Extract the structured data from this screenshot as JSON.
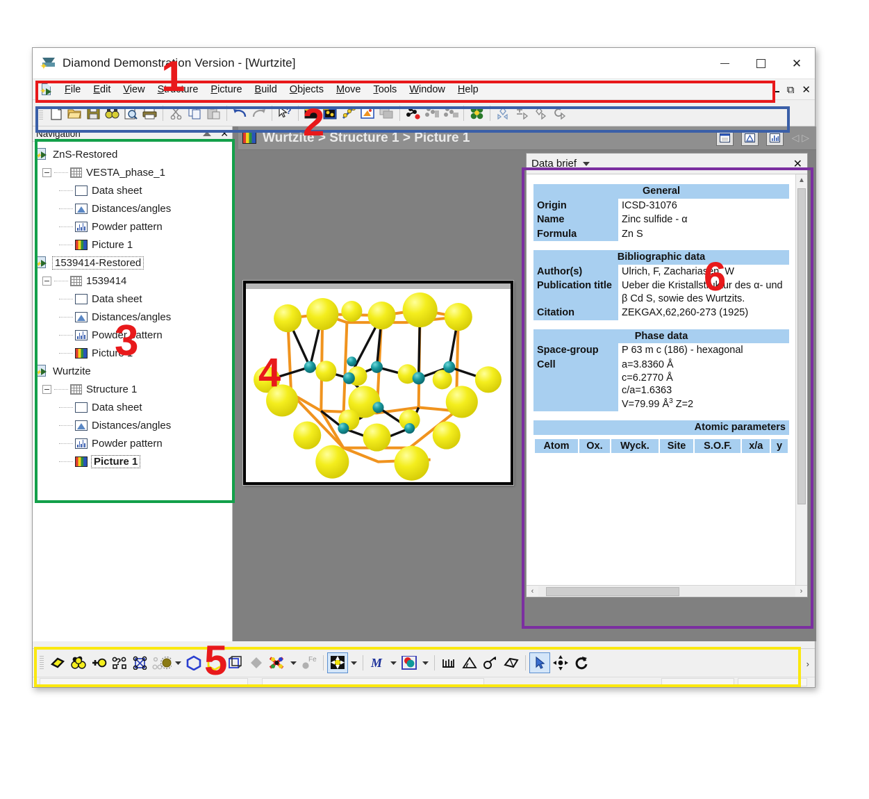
{
  "window": {
    "title": "Diamond Demonstration Version - [Wurtzite]",
    "app_icon": "diamond-icon",
    "minimize": "—",
    "maximize": "□",
    "close": "✕"
  },
  "menubar": {
    "doc_icon": "structure-document-icon",
    "items": [
      {
        "label": "File",
        "mnemonic": "F"
      },
      {
        "label": "Edit",
        "mnemonic": "E"
      },
      {
        "label": "View",
        "mnemonic": "V"
      },
      {
        "label": "Structure",
        "mnemonic": "S"
      },
      {
        "label": "Picture",
        "mnemonic": "P"
      },
      {
        "label": "Build",
        "mnemonic": "B"
      },
      {
        "label": "Objects",
        "mnemonic": "O"
      },
      {
        "label": "Move",
        "mnemonic": "M"
      },
      {
        "label": "Tools",
        "mnemonic": "T"
      },
      {
        "label": "Window",
        "mnemonic": "W"
      },
      {
        "label": "Help",
        "mnemonic": "H"
      }
    ],
    "mdi_restore": "❐",
    "mdi_close": "✕"
  },
  "toolbar_top": {
    "buttons": [
      {
        "name": "new-icon",
        "tip": "New"
      },
      {
        "name": "open-folder-icon",
        "tip": "Open"
      },
      {
        "name": "save-disk-icon",
        "tip": "Save"
      },
      {
        "name": "find-binoculars-icon",
        "tip": "Find"
      },
      {
        "name": "print-preview-icon",
        "tip": "Print preview"
      },
      {
        "name": "print-icon",
        "tip": "Print"
      },
      {
        "name": "cut-scissors-icon",
        "tip": "Cut"
      },
      {
        "name": "copy-icon",
        "tip": "Copy"
      },
      {
        "name": "paste-icon",
        "tip": "Paste"
      },
      {
        "name": "undo-icon",
        "tip": "Undo"
      },
      {
        "name": "redo-icon",
        "tip": "Redo"
      },
      {
        "name": "help-pointer-icon",
        "tip": "Context help"
      },
      {
        "name": "picture-new-icon",
        "tip": "New picture"
      },
      {
        "name": "structure-picture-icon",
        "tip": "Structure picture"
      },
      {
        "name": "build-wand-icon",
        "tip": "Build"
      },
      {
        "name": "export-picture-icon",
        "tip": "Export picture"
      },
      {
        "name": "table-icon",
        "tip": "Table"
      },
      {
        "name": "add-atom-icon",
        "tip": "Add atom"
      },
      {
        "name": "atom-group-1-icon",
        "tip": "Atom group"
      },
      {
        "name": "atom-group-2-icon",
        "tip": "Atom group"
      },
      {
        "name": "molecule-cluster-icon",
        "tip": "Molecule"
      },
      {
        "name": "symmetry-icon",
        "tip": "Symmetry"
      },
      {
        "name": "translate-icon",
        "tip": "Translate"
      },
      {
        "name": "mirror-icon",
        "tip": "Mirror"
      },
      {
        "name": "rotate-icon",
        "tip": "Rotate"
      }
    ]
  },
  "navigation": {
    "header_title": "Navigation",
    "pin_icon": "auto-hide-pin-icon",
    "close_icon": "close-icon",
    "tree": [
      {
        "level": 0,
        "icon": "structure-doc-icon",
        "label": "ZnS-Restored",
        "expander": false,
        "state": "normal"
      },
      {
        "level": 1,
        "icon": "grid-icon",
        "label": "VESTA_phase_1",
        "expander": true,
        "state": "normal"
      },
      {
        "level": 2,
        "icon": "data-sheet-icon",
        "label": "Data sheet",
        "expander": false,
        "state": "normal"
      },
      {
        "level": 2,
        "icon": "distances-angles-icon",
        "label": "Distances/angles",
        "expander": false,
        "state": "normal"
      },
      {
        "level": 2,
        "icon": "powder-pattern-icon",
        "label": "Powder pattern",
        "expander": false,
        "state": "normal"
      },
      {
        "level": 2,
        "icon": "picture-icon",
        "label": "Picture 1",
        "expander": false,
        "state": "normal"
      },
      {
        "level": 0,
        "icon": "structure-doc-icon",
        "label": "1539414-Restored",
        "expander": false,
        "state": "focus"
      },
      {
        "level": 1,
        "icon": "grid-icon",
        "label": "1539414",
        "expander": true,
        "state": "normal"
      },
      {
        "level": 2,
        "icon": "data-sheet-icon",
        "label": "Data sheet",
        "expander": false,
        "state": "normal"
      },
      {
        "level": 2,
        "icon": "distances-angles-icon",
        "label": "Distances/angles",
        "expander": false,
        "state": "normal"
      },
      {
        "level": 2,
        "icon": "powder-pattern-icon",
        "label": "Powder pattern",
        "expander": false,
        "state": "normal"
      },
      {
        "level": 2,
        "icon": "picture-icon",
        "label": "Picture 1",
        "expander": false,
        "state": "normal"
      },
      {
        "level": 0,
        "icon": "structure-doc-icon",
        "label": "Wurtzite",
        "expander": false,
        "state": "normal"
      },
      {
        "level": 1,
        "icon": "grid-icon",
        "label": "Structure 1",
        "expander": true,
        "state": "normal"
      },
      {
        "level": 2,
        "icon": "data-sheet-icon",
        "label": "Data sheet",
        "expander": false,
        "state": "normal"
      },
      {
        "level": 2,
        "icon": "distances-angles-icon",
        "label": "Distances/angles",
        "expander": false,
        "state": "normal"
      },
      {
        "level": 2,
        "icon": "powder-pattern-icon",
        "label": "Powder pattern",
        "expander": false,
        "state": "normal"
      },
      {
        "level": 2,
        "icon": "picture-icon",
        "label": "Picture 1",
        "expander": false,
        "state": "selected"
      }
    ]
  },
  "document": {
    "icon": "picture-icon",
    "breadcrumb": "Wurtzite > Structure 1 > Picture 1",
    "tab_icons": [
      "data-sheet-tab-icon",
      "distances-angles-tab-icon",
      "powder-pattern-tab-icon"
    ],
    "nav_arrows": "◁ ▷"
  },
  "picture": {
    "name": "wurtzite-crystal-structure",
    "anion_color": "#f2ec1a",
    "cation_color": "#1f9aa0",
    "bond_color_a": "#f0931e",
    "bond_color_b": "#111111",
    "background": "#ffffff"
  },
  "data_brief": {
    "title": "Data brief",
    "dropdown_icon": "chevron-down-icon",
    "close_icon": "close-icon",
    "sections": {
      "general": {
        "header": "General",
        "rows": [
          {
            "key": "Origin",
            "value": "ICSD-31076"
          },
          {
            "key": "Name",
            "value": "Zinc sulfide - α"
          },
          {
            "key": "Formula",
            "value": "Zn S"
          }
        ]
      },
      "bibliographic": {
        "header": "Bibliographic data",
        "rows": [
          {
            "key": "Author(s)",
            "value": "Ulrich, F, Zachariasen, W"
          },
          {
            "key": "Publication title",
            "value": "Ueber die Kristallstruktur des α- und β Cd S, sowie des Wurtzits."
          },
          {
            "key": "Citation",
            "value": "ZEKGAX,62,260-273 (1925)"
          }
        ]
      },
      "phase": {
        "header": "Phase data",
        "rows": [
          {
            "key": "Space-group",
            "value": "P 63 m c (186) - hexagonal"
          },
          {
            "key": "Cell",
            "value_lines": [
              "a=3.8360 Å",
              "c=6.2770 Å",
              "c/a=1.6363"
            ],
            "volume_prefix": "V=79.99 Å",
            "volume_sup": "3",
            "volume_suffix": " Z=2"
          }
        ]
      },
      "atomic": {
        "header": "Atomic parameters",
        "columns": [
          "Atom",
          "Ox.",
          "Wyck.",
          "Site",
          "S.O.F.",
          "x/a",
          "y"
        ]
      }
    },
    "vscroll": {
      "up": "▲",
      "down": "▼"
    },
    "hscroll": {
      "left": "‹",
      "right": "›"
    }
  },
  "toolbar_bottom": {
    "buttons": [
      {
        "name": "atom-design-icon"
      },
      {
        "name": "atom-group-spheres-icon"
      },
      {
        "name": "add-bond-atom-icon"
      },
      {
        "name": "atom-query-icon"
      },
      {
        "name": "polyhedra-net-icon"
      },
      {
        "name": "coordination-sphere-icon"
      },
      {
        "name": "dropdown-caret-1-icon"
      },
      {
        "name": "polyhedron-blue-icon"
      },
      {
        "name": "polyhedron-yellow-icon"
      },
      {
        "name": "unit-cell-box-icon"
      },
      {
        "name": "plane-diamond-icon"
      },
      {
        "name": "molecule-red-icon"
      },
      {
        "name": "dropdown-caret-2-icon"
      },
      {
        "name": "element-fe-icon"
      },
      {
        "name": "symmetry-center-icon"
      },
      {
        "name": "dropdown-caret-3-icon"
      },
      {
        "name": "magnetic-moment-icon"
      },
      {
        "name": "dropdown-caret-4-icon"
      },
      {
        "name": "color-map-icon"
      },
      {
        "name": "dropdown-caret-5-icon"
      },
      {
        "name": "ruler-icon"
      },
      {
        "name": "angle-icon"
      },
      {
        "name": "torsion-icon"
      },
      {
        "name": "area-icon"
      },
      {
        "name": "select-pointer-icon"
      },
      {
        "name": "move-cross-icon"
      },
      {
        "name": "rotate-arrow-icon"
      },
      {
        "name": "overflow-chevron-icon"
      }
    ]
  },
  "annotations": [
    {
      "id": "1",
      "label": "1",
      "target": "menubar",
      "color": "#e8191b",
      "box_color": "#e8191b"
    },
    {
      "id": "2",
      "label": "2",
      "target": "toolbar-top",
      "color": "#e8191b",
      "box_color": "#3a5fa8"
    },
    {
      "id": "3",
      "label": "3",
      "target": "navigation-panel",
      "color": "#e8191b",
      "box_color": "#13a04a"
    },
    {
      "id": "4",
      "label": "4",
      "target": "picture-canvas",
      "color": "#e8191b",
      "box_color": null
    },
    {
      "id": "5",
      "label": "5",
      "target": "toolbar-bottom",
      "color": "#e8191b",
      "box_color": "#fbe80f"
    },
    {
      "id": "6",
      "label": "6",
      "target": "data-brief-panel",
      "color": "#e8191b",
      "box_color": "#7b2fa0"
    }
  ]
}
